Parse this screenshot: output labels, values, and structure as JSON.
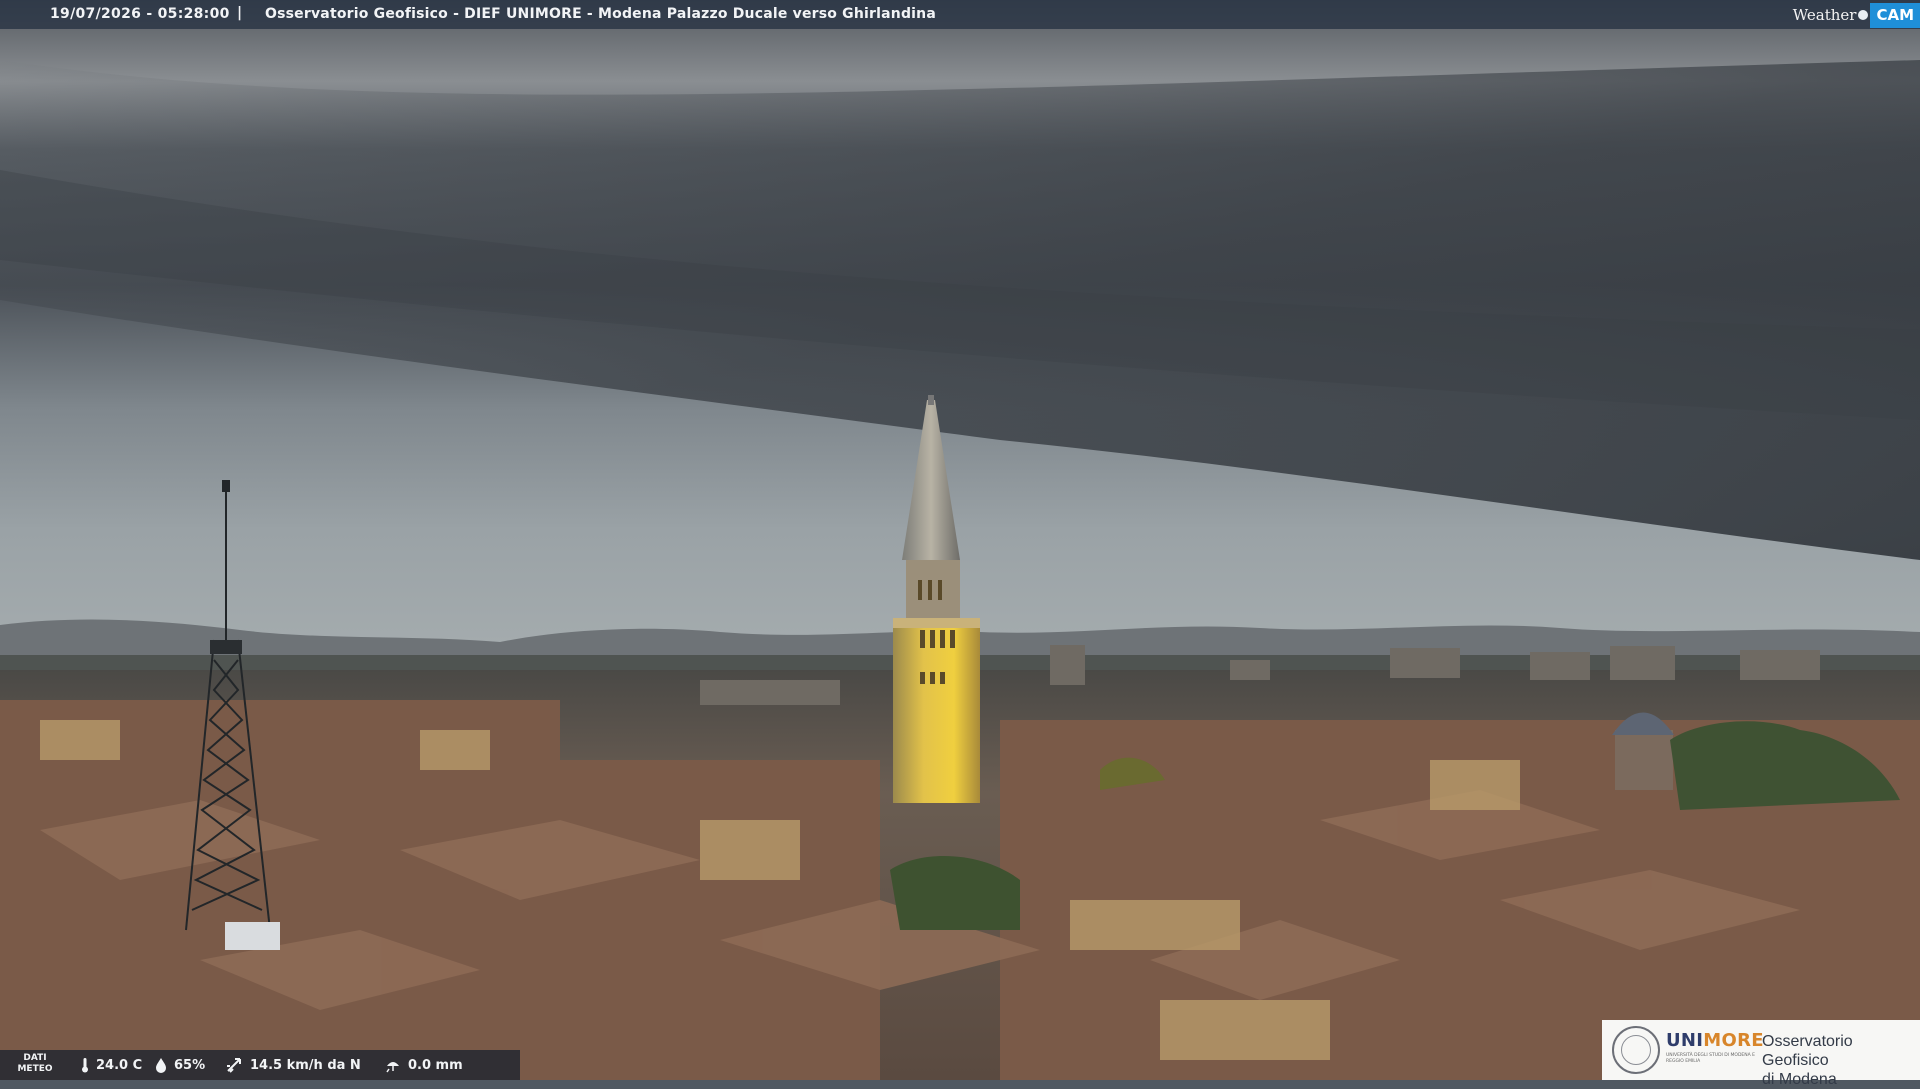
{
  "header": {
    "timestamp": "19/07/2026 - 05:28:00",
    "separator": "|",
    "title": "Osservatorio Geofisico - DIEF UNIMORE - Modena Palazzo Ducale verso Ghirlandina"
  },
  "brand": {
    "weather": "Weather",
    "cam": "CAM",
    "cam_color": "#1f8fd8"
  },
  "meteo": {
    "label_line1": "DATI",
    "label_line2": "METEO",
    "temperature": "24.0 C",
    "humidity": "65%",
    "wind": "14.5 km/h da N",
    "rain": "0.0 mm",
    "icons": [
      "thermometer-icon",
      "humidity-drop-icon",
      "wind-icon",
      "rain-icon"
    ]
  },
  "logo": {
    "name_part1": "UNI",
    "name_part2": "MORE",
    "subtitle": "UNIVERSITÀ DEGLI STUDI DI MODENA E REGGIO EMILIA",
    "observatory_line1": "Osservatorio Geofisico",
    "observatory_line2": "di Modena",
    "colors": {
      "navy": "#2f3d6b",
      "orange": "#d8862b"
    }
  },
  "scene": {
    "description_icon": "webcam-cityscape-image"
  }
}
